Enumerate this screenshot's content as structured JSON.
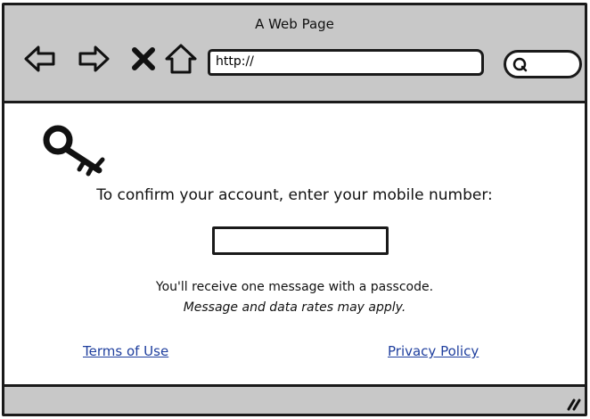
{
  "window": {
    "title": "A Web Page"
  },
  "toolbar": {
    "back_icon": "back-arrow-icon",
    "forward_icon": "forward-arrow-icon",
    "stop_icon": "close-icon",
    "home_icon": "home-icon",
    "url": "http://",
    "search_icon": "search-icon"
  },
  "page": {
    "icon": "key-icon",
    "prompt": "To confirm your account, enter your mobile number:",
    "phone_value": "",
    "note": "You'll receive one message with a passcode.",
    "note_italic": "Message and data rates may apply.",
    "terms_link": "Terms of Use",
    "privacy_link": "Privacy Policy"
  },
  "colors": {
    "chrome_bg": "#c8c8c8",
    "link": "#1f3f9e",
    "border": "#1a1a1a"
  }
}
